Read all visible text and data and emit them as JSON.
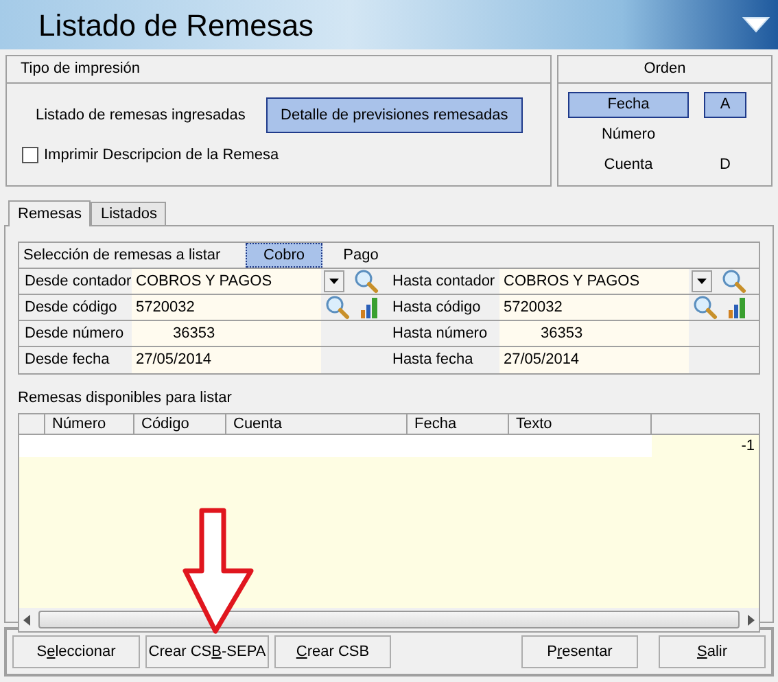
{
  "window": {
    "title": "Listado de Remesas"
  },
  "print_type": {
    "title": "Tipo de impresión",
    "options": [
      {
        "label": "Listado de remesas ingresadas",
        "selected": false
      },
      {
        "label": "Detalle de previsiones remesadas",
        "selected": true
      }
    ],
    "checkbox": {
      "label": "Imprimir Descripcion de la Remesa",
      "checked": false
    }
  },
  "order": {
    "title": "Orden",
    "items": [
      {
        "label": "Fecha",
        "selected": true,
        "direction": "A"
      },
      {
        "label": "Número",
        "selected": false
      },
      {
        "label": "Cuenta",
        "selected": false,
        "direction": "D"
      }
    ]
  },
  "tabs": [
    {
      "label": "Remesas",
      "selected": true
    },
    {
      "label": "Listados",
      "selected": false
    }
  ],
  "selection": {
    "title": "Selección de remesas a listar",
    "options": [
      {
        "label": "Cobro",
        "selected": true
      },
      {
        "label": "Pago",
        "selected": false
      }
    ],
    "rows": [
      {
        "kind": "combo",
        "left": {
          "label": "Desde contador",
          "value": "COBROS Y PAGOS"
        },
        "right": {
          "label": "Hasta contador",
          "value": "COBROS Y PAGOS"
        }
      },
      {
        "kind": "lookup",
        "left": {
          "label": "Desde código",
          "value": "5720032"
        },
        "right": {
          "label": "Hasta código",
          "value": "5720032"
        }
      },
      {
        "kind": "number",
        "left": {
          "label": "Desde número",
          "value": "36353"
        },
        "right": {
          "label": "Hasta número",
          "value": "36353"
        }
      },
      {
        "kind": "date",
        "left": {
          "label": "Desde fecha",
          "value": "27/05/2014"
        },
        "right": {
          "label": "Hasta fecha",
          "value": "27/05/2014"
        }
      }
    ]
  },
  "table": {
    "title": "Remesas disponibles para listar",
    "columns": [
      "Número",
      "Código",
      "Cuenta",
      "Fecha",
      "Texto"
    ],
    "rows": [
      {
        "selected": true,
        "column_7": "-1"
      }
    ]
  },
  "buttons": [
    {
      "pre": "S",
      "key": "e",
      "post": "leccionar"
    },
    {
      "pre": "Crear CS",
      "key": "B",
      "post": "-SEPA"
    },
    {
      "key": "C",
      "post": "rear CSB"
    },
    {
      "pre": "P",
      "key": "r",
      "post": "esentar"
    },
    {
      "key": "S",
      "post": "alir"
    }
  ]
}
